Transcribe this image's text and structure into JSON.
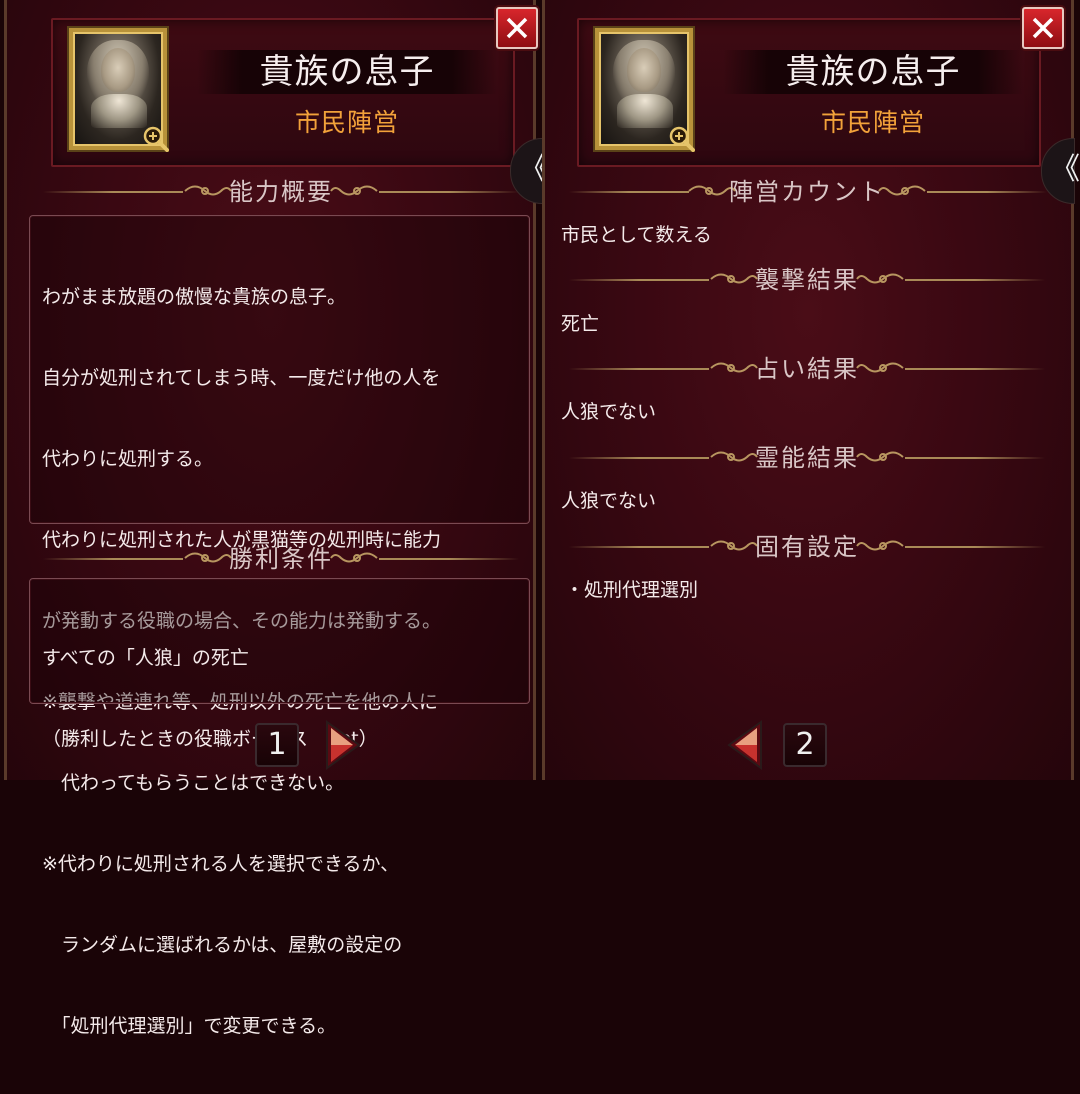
{
  "panels": [
    {
      "title": "貴族の息子",
      "faction": "市民陣営",
      "sections": [
        {
          "heading": "能力概要",
          "lines": [
            "わがまま放題の傲慢な貴族の息子。",
            "自分が処刑されてしまう時、一度だけ他の人を",
            "代わりに処刑する。",
            "代わりに処刑された人が黒猫等の処刑時に能力",
            "が発動する役職の場合、その能力は発動する。",
            "※襲撃や道連れ等、処刑以外の死亡を他の人に",
            "　代わってもらうことはできない。",
            "※代わりに処刑される人を選択できるか、",
            "　ランダムに選ばれるかは、屋敷の設定の",
            "　「処刑代理選別」で変更できる。"
          ]
        },
        {
          "heading": "勝利条件",
          "lines": [
            "すべての「人狼」の死亡",
            "（勝利したときの役職ボーナス　8pt）"
          ]
        }
      ],
      "page": "1",
      "next_icon": "next-arrow-icon"
    },
    {
      "title": "貴族の息子",
      "faction": "市民陣営",
      "sections": [
        {
          "heading": "陣営カウント",
          "text": "市民として数える"
        },
        {
          "heading": "襲撃結果",
          "text": "死亡"
        },
        {
          "heading": "占い結果",
          "text": "人狼でない"
        },
        {
          "heading": "霊能結果",
          "text": "人狼でない"
        },
        {
          "heading": "固有設定",
          "text": "・処刑代理選別"
        }
      ],
      "page": "2",
      "prev_icon": "prev-arrow-icon"
    }
  ],
  "icons": {
    "close": "close-icon",
    "zoom": "zoom-plus-icon",
    "side_tab": "chevron-left-icon"
  },
  "side_tab_glyph": "《",
  "colors": {
    "background": "#3a0812",
    "faction_text": "#f2a23a",
    "close_button": "#d8262c",
    "gold_accent": "#b8923a"
  }
}
